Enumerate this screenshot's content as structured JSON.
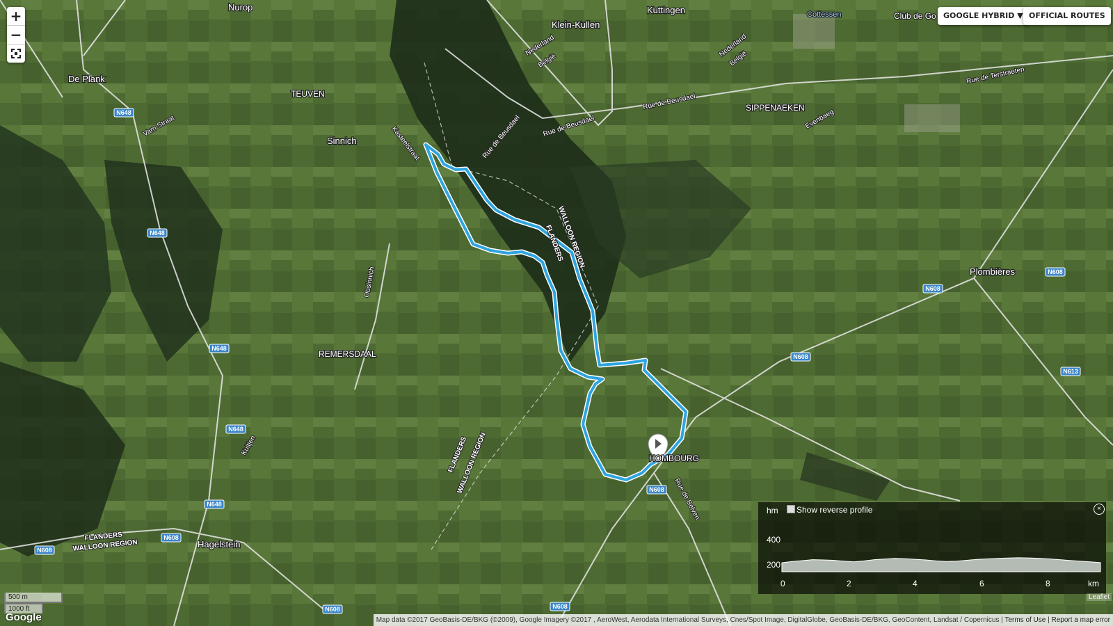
{
  "controls": {
    "zoom_in": "+",
    "zoom_out": "−",
    "fullscreen_icon": "fullscreen-icon",
    "layer_button": "GOOGLE HYBRID ▼",
    "routes_button": "OFFICIAL ROUTES"
  },
  "places": {
    "nurop": "Nurop",
    "kuttingen": "Kuttingen",
    "klein_kullen": "Klein-Kullen",
    "cottessen": "Cottessen",
    "club": "Club de Go",
    "de_plank": "De Plank",
    "teuven": "TEUVEN",
    "sinnich": "Sinnich",
    "sippenaeken": "SIPPENAEKEN",
    "plombieres": "Plombières",
    "remersdaal": "REMERSDAAL",
    "hombourg": "HOMBOURG",
    "hagelstein": "Hagelstein"
  },
  "roads": {
    "kasteelstraat": "Kasteelstraat",
    "rue_beusdael_1": "Rue de Beusdael",
    "rue_beusdael_2": "Rue de Beusdael",
    "rue_beusdael_3": "Rue de Beusdael",
    "rue_terstraeten": "Rue de Terstraeten",
    "evenbaeg": "Evenbaeg",
    "varn_straat": "Varn Straat",
    "obsinnich": "Obsinnich",
    "kuitjen": "Kuitjen",
    "rue_belven": "Rue de Belven",
    "nederland_1": "Nederland",
    "belgie_1": "België",
    "nederland_2": "Nederland",
    "belgie_2": "België",
    "walloon_1": "WALLOON REGION",
    "flanders_1": "FLANDERS",
    "flanders_2": "FLANDERS",
    "walloon_2": "WALLOON REGION",
    "flanders_3": "FLANDERS",
    "walloon_3": "WALLOON REGION",
    "n648": "N648",
    "n608": "N608",
    "n613": "N613"
  },
  "elevation": {
    "unit_y": "hm",
    "toggle_label": "Show reverse profile",
    "y_ticks": [
      "400",
      "200"
    ],
    "x_ticks": [
      "0",
      "2",
      "4",
      "6",
      "8"
    ],
    "unit_x": "km",
    "close": "×",
    "profile_m": [
      205,
      215,
      222,
      230,
      228,
      225,
      218,
      212,
      220,
      230,
      235,
      240,
      238,
      233,
      228,
      220,
      215,
      218,
      225,
      232,
      236,
      240,
      243,
      245,
      244,
      241,
      236,
      230,
      224,
      218,
      212,
      206
    ]
  },
  "scale": {
    "metric": "500 m",
    "imperial": "1000 ft"
  },
  "logo": "Google",
  "leaflet": "Leaflet",
  "attribution": {
    "text": "Map data ©2017 GeoBasis-DE/BKG (©2009), Google Imagery ©2017 , AeroWest, Aerodata International Surveys, Cnes/Spot Image, DigitalGlobe, GeoBasis-DE/BKG, GeoContent, Landsat / Copernicus",
    "terms": "Terms of Use",
    "report": "Report a map error"
  },
  "colors": {
    "route": "#2fa4e0",
    "route_casing": "#ffffff",
    "forest": "#1f2f1a",
    "field": "#4f6c35",
    "road": "#e8e8e8",
    "shield": "#3a86c9"
  }
}
